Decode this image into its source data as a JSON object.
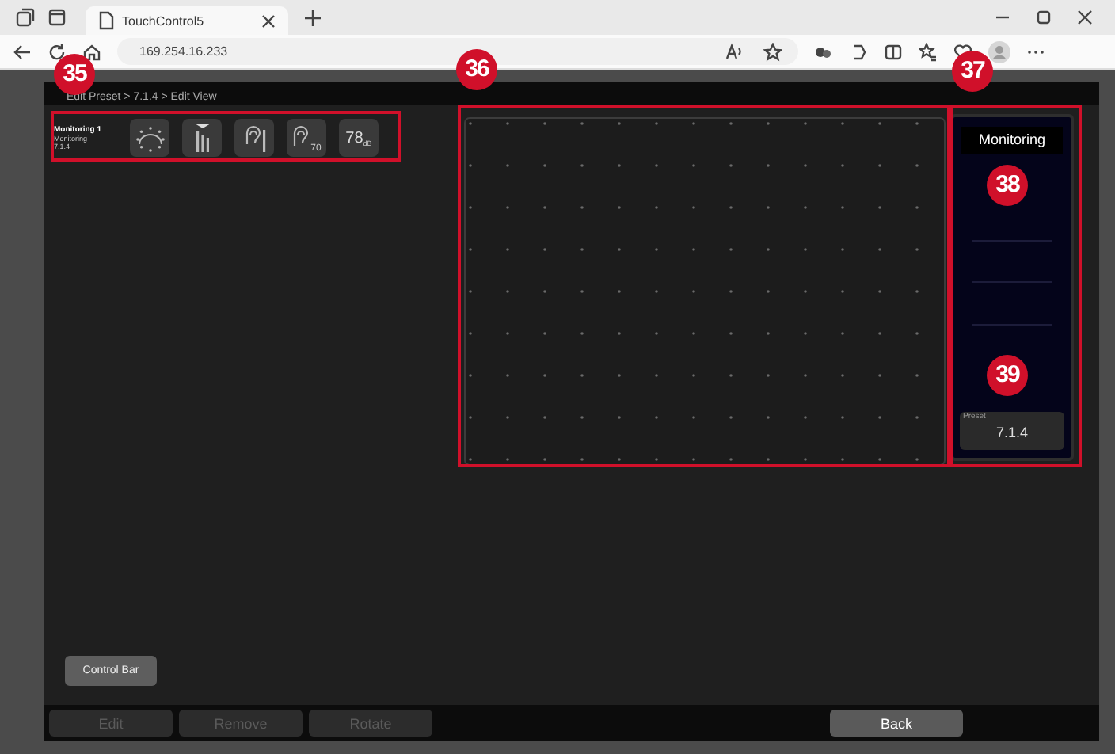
{
  "browser": {
    "tab_title": "TouchControl5",
    "address": "169.254.16.233"
  },
  "breadcrumb": "Edit Preset > 7.1.4 > Edit View",
  "strip": {
    "title": "Monitoring 1",
    "subtitle": "Monitoring",
    "preset": "7.1.4",
    "tools": [
      {
        "kind": "speaker"
      },
      {
        "kind": "bars"
      },
      {
        "kind": "ear-bar"
      },
      {
        "kind": "ear",
        "label": "70"
      },
      {
        "kind": "level",
        "label": "78",
        "unit": "dB"
      }
    ]
  },
  "monitor": {
    "title": "Monitoring",
    "preset_label": "Preset",
    "preset_value": "7.1.4"
  },
  "control_bar_button": "Control Bar",
  "actions": [
    {
      "label": "Edit",
      "disabled": true
    },
    {
      "label": "Remove",
      "disabled": true
    },
    {
      "label": "Rotate",
      "disabled": true
    },
    {
      "label": "Back",
      "disabled": false
    }
  ],
  "callouts": [
    {
      "number": "35"
    },
    {
      "number": "36"
    },
    {
      "number": "37"
    },
    {
      "number": "38"
    },
    {
      "number": "39"
    }
  ]
}
